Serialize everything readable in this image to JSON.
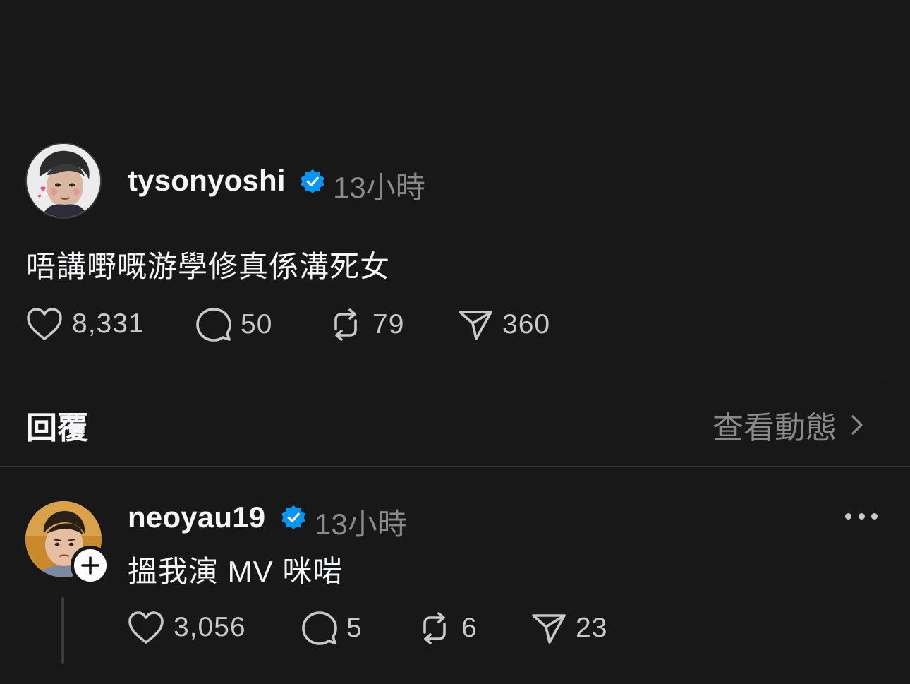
{
  "post": {
    "username": "tysonyoshi",
    "verified": true,
    "time": "13小時",
    "text": "唔講嘢嘅游學修真係溝死女",
    "counts": {
      "likes": "8,331",
      "comments": "50",
      "reposts": "79",
      "shares": "360"
    }
  },
  "replies_section": {
    "label": "回覆",
    "view_activity": "查看動態"
  },
  "reply": {
    "username": "neoyau19",
    "verified": true,
    "time": "13小時",
    "text": "搵我演 MV 咪啱",
    "counts": {
      "likes": "3,056",
      "comments": "5",
      "reposts": "6",
      "shares": "23"
    }
  },
  "colors": {
    "background": "#181818",
    "text": "#f3f5f7",
    "muted": "#8a8a8a",
    "verified": "#0095f6"
  },
  "icons": [
    "heart-icon",
    "comment-icon",
    "repost-icon",
    "share-icon",
    "verified-icon",
    "plus-icon",
    "chevron-right-icon",
    "more-icon"
  ]
}
